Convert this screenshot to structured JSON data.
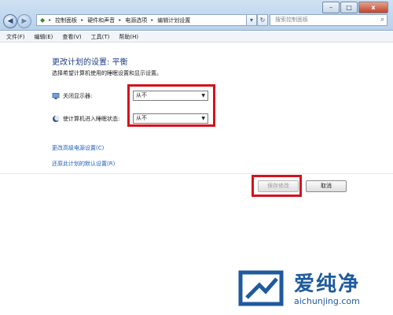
{
  "window": {
    "min_label": "–",
    "max_label": "□",
    "close_label": "x"
  },
  "nav": {
    "back": "◀",
    "forward": "▶"
  },
  "address": {
    "crumbs": [
      "控制面板",
      "硬件和声音",
      "电源选项",
      "编辑计划设置"
    ],
    "separator": "▸"
  },
  "search": {
    "placeholder": "搜索控制面板"
  },
  "menu": {
    "items": [
      "文件(F)",
      "编辑(E)",
      "查看(V)",
      "工具(T)",
      "帮助(H)"
    ]
  },
  "content": {
    "title": "更改计划的设置: 平衡",
    "description": "选择希望计算机使用的睡眠设置和显示设置。",
    "settings": [
      {
        "label": "关闭显示器:",
        "value": "从不",
        "icon": "monitor-icon"
      },
      {
        "label": "使计算机进入睡眠状态:",
        "value": "从不",
        "icon": "moon-icon"
      }
    ],
    "links": [
      "更改高级电源设置(C)",
      "还原此计划的默认设置(R)"
    ],
    "buttons": {
      "save": "保存修改",
      "cancel": "取消"
    }
  },
  "watermark": {
    "brand": "爱纯净",
    "url": "aichunjing.com"
  },
  "colors": {
    "highlight": "#d4121c",
    "link": "#1f5fba",
    "title": "#1e3e8c"
  }
}
